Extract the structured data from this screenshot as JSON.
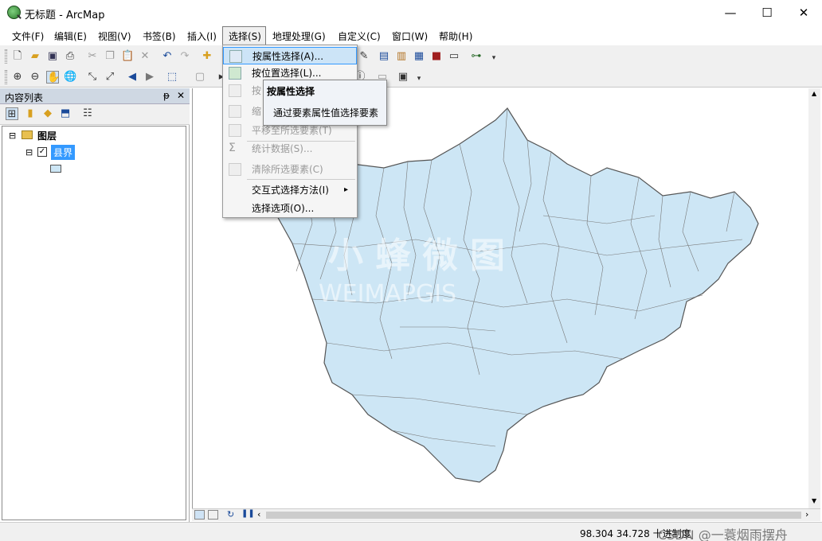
{
  "window": {
    "title": "无标题 - ArcMap",
    "minimize": "—",
    "maximize": "☐",
    "close": "✕"
  },
  "menubar": [
    "文件(F)",
    "编辑(E)",
    "视图(V)",
    "书签(B)",
    "插入(I)",
    "选择(S)",
    "地理处理(G)",
    "自定义(C)",
    "窗口(W)",
    "帮助(H)"
  ],
  "toc": {
    "title": "内容列表",
    "pin": "ᵽ",
    "close": "✕",
    "root": "图层",
    "layer": "县界",
    "expand_root": "⊟",
    "expand_layer": "⊟"
  },
  "dropdown": {
    "items": [
      {
        "label": "按属性选择(A)...",
        "enabled": true,
        "highlight": true
      },
      {
        "label": "按位置选择(L)...",
        "enabled": true
      },
      {
        "label": "按",
        "enabled": false
      },
      {
        "label": "缩",
        "enabled": false
      },
      {
        "label": "平移至所选要素(T)",
        "enabled": false
      },
      {
        "label": "统计数据(S)...",
        "enabled": false
      },
      {
        "label": "清除所选要素(C)",
        "enabled": false
      },
      {
        "label": "交互式选择方法(I)",
        "enabled": true,
        "arrow": "▸"
      },
      {
        "label": "选择选项(O)...",
        "enabled": true
      }
    ]
  },
  "tooltip": {
    "title": "按属性选择",
    "desc": "通过要素属性值选择要素"
  },
  "status": {
    "coords": "98.304  34.728 十进制度",
    "credit": "CSDN @一蓑烟雨摆舟"
  },
  "watermark": {
    "cn": "小 蜂 微 图",
    "en": "WEIMAPGIS"
  },
  "colors": {
    "accent": "#3399ff",
    "map_fill": "#cde6f5",
    "map_stroke": "#555555",
    "highlight_bg": "#cce4f7"
  }
}
